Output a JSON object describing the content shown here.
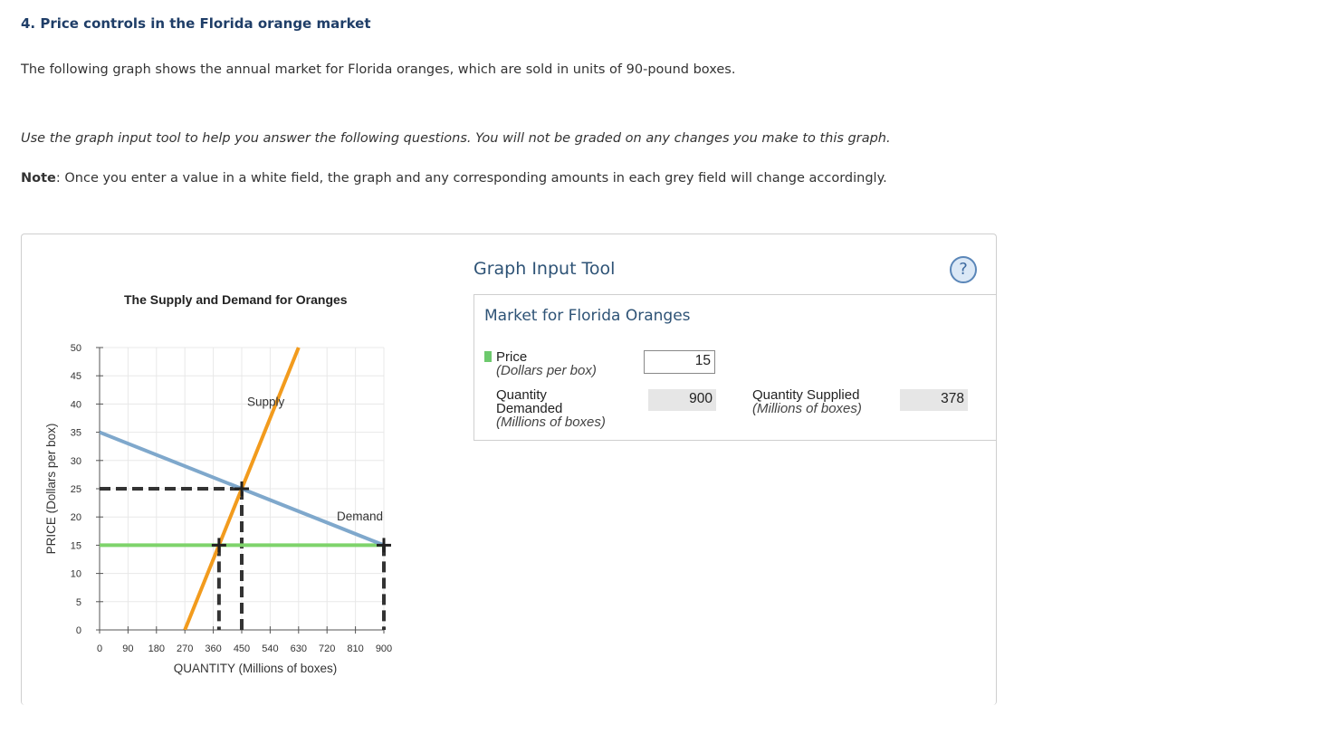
{
  "page": {
    "question_title": "4. Price controls in the Florida orange market",
    "intro": "The following graph shows the annual market for Florida oranges, which are sold in units of 90-pound boxes.",
    "instructions": "Use the graph input tool to help you answer the following questions. You will not be graded on any changes you make to this graph.",
    "note_label": "Note",
    "note_text": ": Once you enter a value in a white field, the graph and any corresponding amounts in each grey field will change accordingly."
  },
  "tool": {
    "title": "Graph Input Tool",
    "help_label": "?",
    "panel_title": "Market for Florida Oranges",
    "price_label": "Price",
    "price_unit": "(Dollars per box)",
    "price_value": "15",
    "qd_label_1": "Quantity",
    "qd_label_2": "Demanded",
    "qd_unit": "(Millions of boxes)",
    "qd_value": "900",
    "qs_label": "Quantity Supplied",
    "qs_unit": "(Millions of boxes)",
    "qs_value": "378"
  },
  "colors": {
    "supply": "#f29b1d",
    "demand": "#7fa8cc",
    "price_line": "#7ed36b",
    "dashed": "#333333",
    "grid": "#e8e8e8"
  },
  "chart_data": {
    "type": "line",
    "title": "The Supply and Demand for Oranges",
    "xlabel": "QUANTITY (Millions of boxes)",
    "ylabel": "PRICE (Dollars per box)",
    "xlim": [
      0,
      900
    ],
    "ylim": [
      0,
      50
    ],
    "xticks": [
      0,
      90,
      180,
      270,
      360,
      450,
      540,
      630,
      720,
      810,
      900
    ],
    "yticks": [
      0,
      5,
      10,
      15,
      20,
      25,
      30,
      35,
      40,
      45,
      50
    ],
    "grid": true,
    "series": [
      {
        "name": "Supply",
        "x": [
          270,
          630
        ],
        "y": [
          0,
          50
        ]
      },
      {
        "name": "Demand",
        "x": [
          0,
          900
        ],
        "y": [
          35,
          15
        ]
      }
    ],
    "price_line": {
      "y": 15,
      "x": [
        0,
        900
      ]
    },
    "equilibrium": {
      "x": 450,
      "y": 25
    },
    "markers": [
      {
        "x": 450,
        "y": 25
      },
      {
        "x": 378,
        "y": 15
      },
      {
        "x": 900,
        "y": 15
      }
    ]
  }
}
